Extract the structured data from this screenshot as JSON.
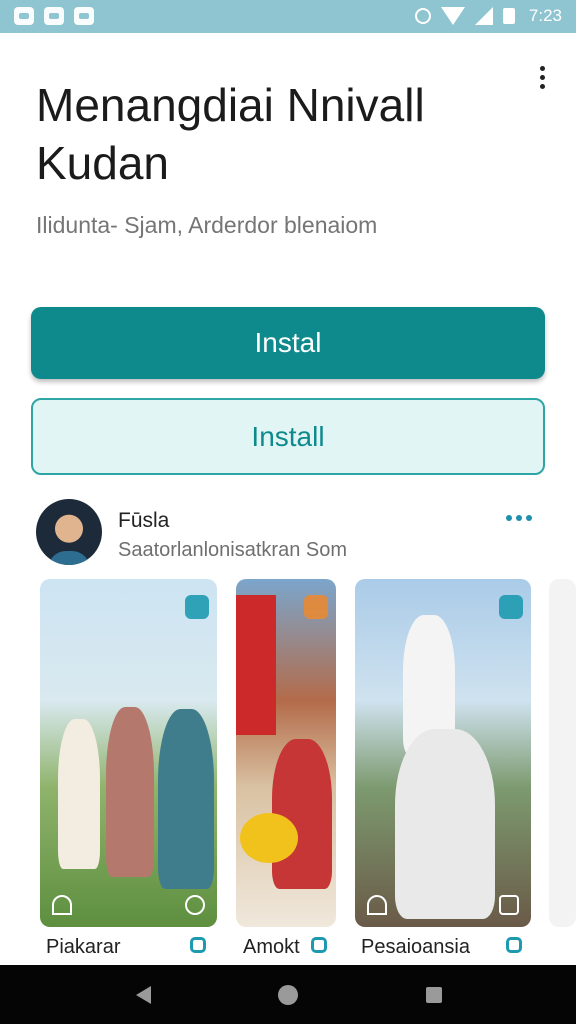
{
  "status_bar": {
    "time": "7:23"
  },
  "app": {
    "title": "Menangdiai Nnivall Kudan",
    "subtitle": "Ilidunta- Sjam, Arderdor blenaiom",
    "install_primary_label": "Instal",
    "install_secondary_label": "Install"
  },
  "author": {
    "name": "Fūsla",
    "subtitle": "Saatorlanlonisatkran Som"
  },
  "cards": [
    {
      "caption": "Piakarar"
    },
    {
      "caption": "Amokt"
    },
    {
      "caption": "Pesaioansia"
    }
  ],
  "colors": {
    "accent": "#0f8a8c",
    "status_bar": "#8fc4d1",
    "secondary_fill": "#e2f5f5"
  }
}
